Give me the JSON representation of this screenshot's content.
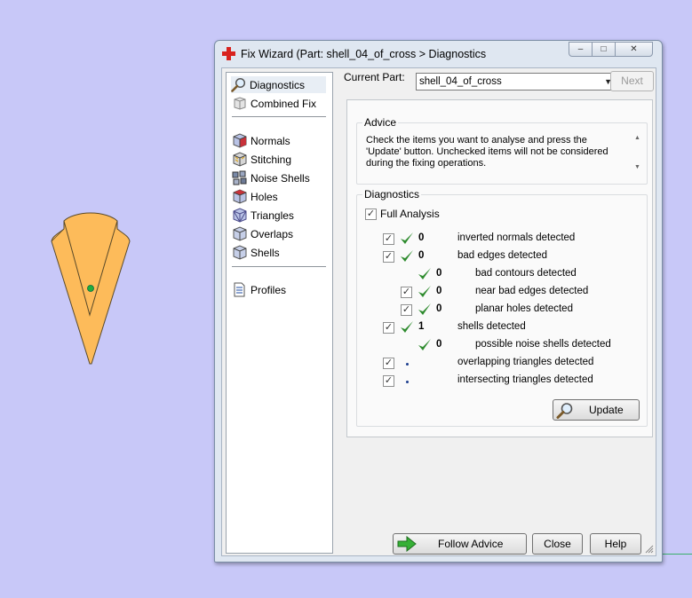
{
  "window": {
    "title": "Fix Wizard (Part: shell_04_of_cross > Diagnostics",
    "minimize_label": "–",
    "maximize_label": "□",
    "close_label": "✕"
  },
  "nav": {
    "items": [
      {
        "label": "Diagnostics",
        "icon": "magnifier-icon",
        "selected": true
      },
      {
        "label": "Combined Fix",
        "icon": "combined-fix-icon"
      },
      {
        "label": "Normals",
        "icon": "normals-cube-icon"
      },
      {
        "label": "Stitching",
        "icon": "stitching-cube-icon"
      },
      {
        "label": "Noise Shells",
        "icon": "noise-shells-icon"
      },
      {
        "label": "Holes",
        "icon": "holes-cube-icon"
      },
      {
        "label": "Triangles",
        "icon": "triangles-cube-icon"
      },
      {
        "label": "Overlaps",
        "icon": "overlaps-cube-icon"
      },
      {
        "label": "Shells",
        "icon": "shells-cube-icon"
      },
      {
        "label": "Profiles",
        "icon": "profiles-document-icon"
      }
    ]
  },
  "current_part": {
    "label": "Current Part:",
    "value": "shell_04_of_cross",
    "next_label": "Next"
  },
  "advice": {
    "title": "Advice",
    "text": "Check the items you want to analyse and press the 'Update' button. Unchecked items will not be considered during the fixing operations."
  },
  "diagnostics": {
    "title": "Diagnostics",
    "full_analysis_label": "Full Analysis",
    "full_analysis_checked": true,
    "rows": [
      {
        "checkbox": true,
        "checked": true,
        "status": "ok",
        "count": "0",
        "label": "inverted normals detected",
        "indent": 0
      },
      {
        "checkbox": true,
        "checked": true,
        "status": "ok",
        "count": "0",
        "label": "bad edges detected",
        "indent": 0
      },
      {
        "checkbox": false,
        "checked": false,
        "status": "ok",
        "count": "0",
        "label": "bad contours detected",
        "indent": 1
      },
      {
        "checkbox": true,
        "checked": true,
        "status": "ok",
        "count": "0",
        "label": "near bad edges detected",
        "indent": 1
      },
      {
        "checkbox": true,
        "checked": true,
        "status": "ok",
        "count": "0",
        "label": "planar holes detected",
        "indent": 1
      },
      {
        "checkbox": true,
        "checked": true,
        "status": "ok",
        "count": "1",
        "label": "shells detected",
        "indent": 0
      },
      {
        "checkbox": false,
        "checked": false,
        "status": "ok",
        "count": "0",
        "label": "possible noise shells detected",
        "indent": 1
      },
      {
        "checkbox": true,
        "checked": true,
        "status": "pending",
        "count": "",
        "label": "overlapping triangles detected",
        "indent": 0
      },
      {
        "checkbox": true,
        "checked": true,
        "status": "pending",
        "count": "",
        "label": "intersecting triangles detected",
        "indent": 0
      }
    ],
    "update_label": "Update"
  },
  "footer": {
    "follow_advice_label": "Follow Advice",
    "close_label": "Close",
    "help_label": "Help"
  },
  "colors": {
    "desktop_bg": "#c8c8f8",
    "part_fill": "#fdbb5a",
    "check_green": "#2e8b2e"
  }
}
